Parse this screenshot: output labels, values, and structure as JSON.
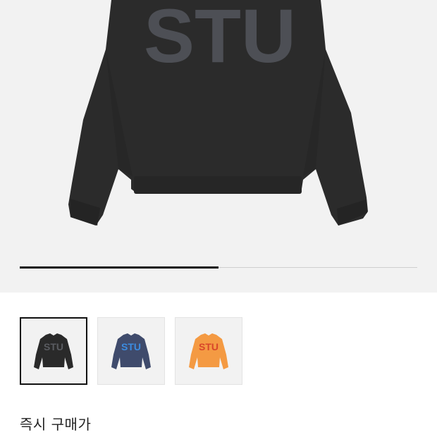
{
  "product": {
    "hero_image": {
      "item": "crewneck sweatshirt",
      "color": "#2b2b2b",
      "print_text": "STU",
      "print_color": "#4d4f55"
    },
    "carousel": {
      "progress_fraction": 0.5
    },
    "variants": [
      {
        "body_color": "#2a2a2a",
        "print_text": "STU",
        "print_color": "#5a5c61",
        "selected": true
      },
      {
        "body_color": "#3f4b6c",
        "print_text": "STU",
        "print_color": "#3c8ce0",
        "selected": false
      },
      {
        "body_color": "#f49a43",
        "print_text": "STU",
        "print_color": "#d8462a",
        "selected": false
      }
    ],
    "instant_buy_label": "즉시 구매가"
  }
}
